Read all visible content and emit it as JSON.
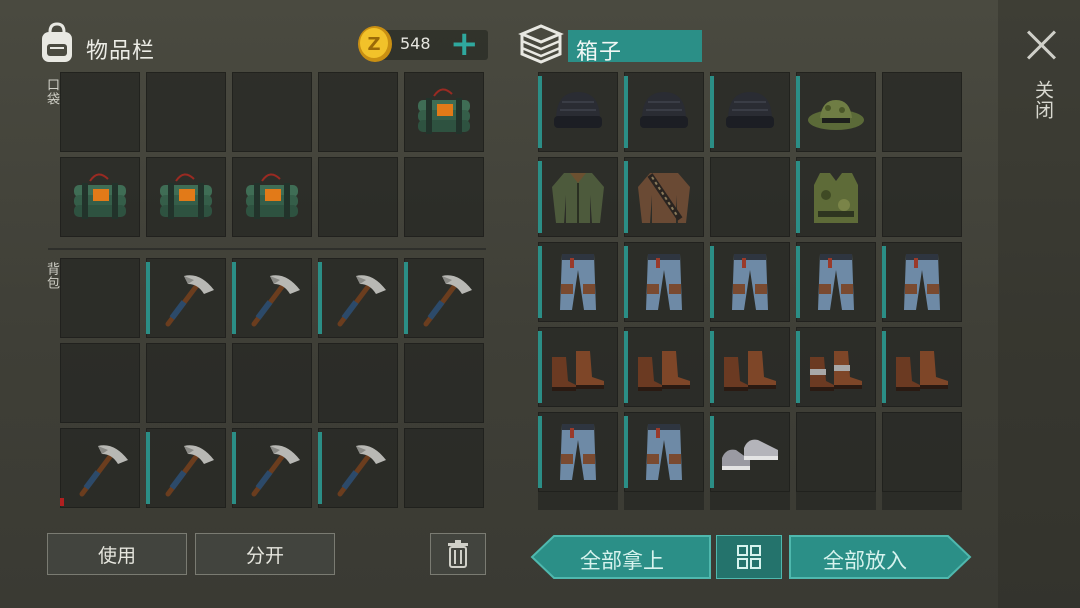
{
  "inventory": {
    "title": "物品栏",
    "pocket_label": "口袋",
    "backpack_label": "背包",
    "currency_value": "548",
    "add_symbol": "+"
  },
  "box": {
    "title": "箱子"
  },
  "close_label": "关闭",
  "buttons": {
    "use": "使用",
    "split": "分开",
    "take_all": "全部拿上",
    "put_all": "全部放入"
  },
  "colors": {
    "accent": "#2b8f87",
    "slot_bg": "#282a25",
    "durability_low": "#b02020"
  },
  "pocket_slots": [
    "empty",
    "empty",
    "empty",
    "empty",
    "explosive",
    "explosive",
    "explosive",
    "explosive",
    "empty",
    "empty"
  ],
  "backpack_slots": [
    "empty",
    "pickaxe",
    "pickaxe",
    "pickaxe",
    "pickaxe",
    "empty",
    "empty",
    "empty",
    "empty",
    "empty",
    "pickaxe",
    "pickaxe",
    "pickaxe",
    "pickaxe",
    "empty"
  ],
  "box_slots": [
    "beanie",
    "beanie",
    "beanie",
    "boonie-hat",
    "empty",
    "bomber-jacket",
    "bandolier-jacket",
    "empty",
    "camo-vest",
    "empty",
    "jeans",
    "jeans",
    "jeans",
    "jeans",
    "jeans",
    "boots",
    "boots",
    "boots",
    "boots-steel",
    "boots",
    "jeans",
    "jeans",
    "sneakers",
    "empty",
    "empty"
  ]
}
